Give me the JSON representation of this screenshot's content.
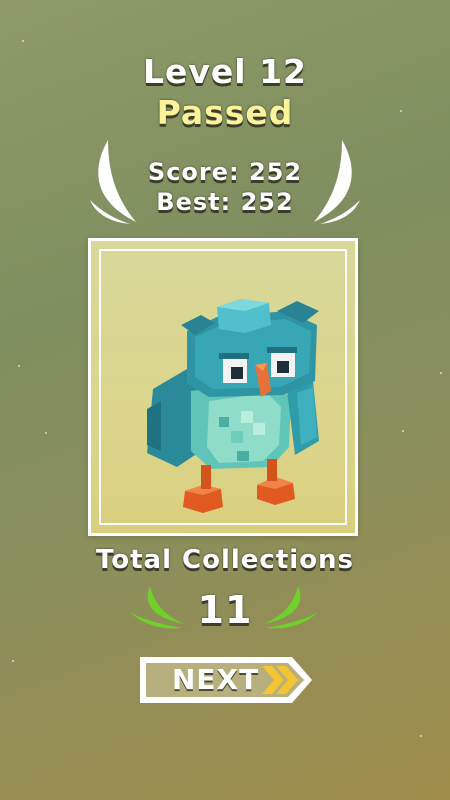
{
  "header": {
    "level_text": "Level 12",
    "status_text": "Passed",
    "score_text": "Score: 252",
    "best_text": "Best: 252"
  },
  "reward": {
    "character": "voxel-owl"
  },
  "collections": {
    "label": "Total Collections",
    "count": "11"
  },
  "actions": {
    "next_label": "NEXT"
  },
  "colors": {
    "passed": "#fbf29a",
    "laurel_green": "#6fd12a",
    "next_chevron": "#f5c531"
  }
}
